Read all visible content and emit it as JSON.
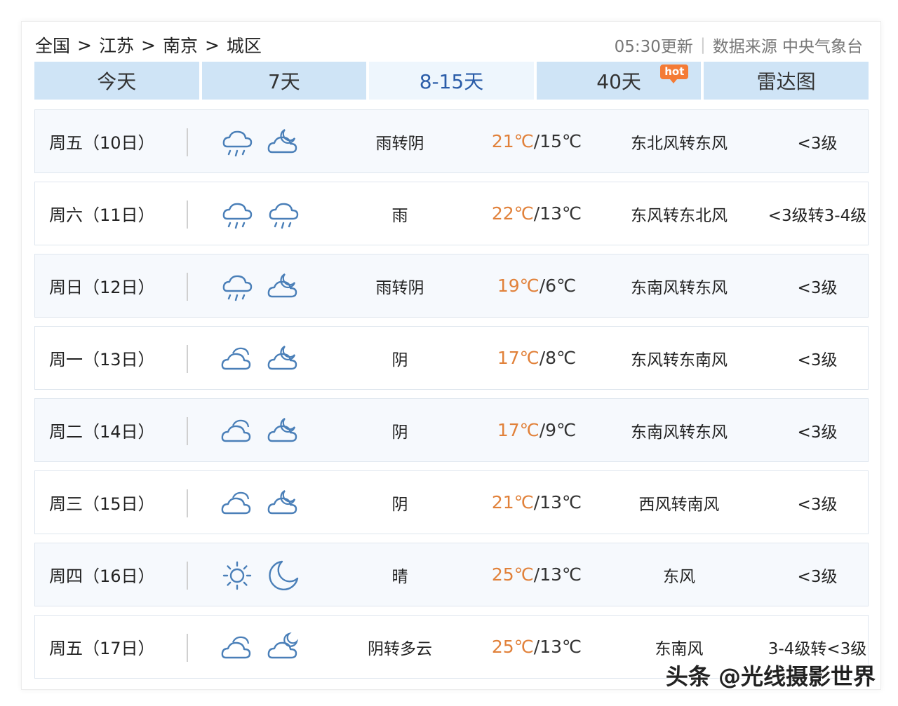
{
  "breadcrumb": [
    "全国",
    "江苏",
    "南京",
    "城区"
  ],
  "breadcrumb_sep": ">",
  "meta": {
    "update": "05:30更新",
    "divider": "|",
    "source": "数据来源 中央气象台"
  },
  "tabs": [
    {
      "label": "今天",
      "active": false
    },
    {
      "label": "7天",
      "active": false
    },
    {
      "label": "8-15天",
      "active": true
    },
    {
      "label": "40天",
      "active": false,
      "badge": "hot"
    },
    {
      "label": "雷达图",
      "active": false
    }
  ],
  "rows": [
    {
      "day": "周五（10日）",
      "icons": [
        "cloud-rain-icon",
        "partly-cloudy-night-icon"
      ],
      "desc": "雨转阴",
      "hi": "21℃",
      "lo": "/15℃",
      "wind": "东北风转东风",
      "level": "<3级"
    },
    {
      "day": "周六（11日）",
      "icons": [
        "cloud-rain-icon",
        "cloud-rain-icon"
      ],
      "desc": "雨",
      "hi": "22℃",
      "lo": "/13℃",
      "wind": "东风转东北风",
      "level": "<3级转3-4级"
    },
    {
      "day": "周日（12日）",
      "icons": [
        "cloud-rain-icon",
        "partly-cloudy-night-icon"
      ],
      "desc": "雨转阴",
      "hi": "19℃",
      "lo": "/6℃",
      "wind": "东南风转东风",
      "level": "<3级"
    },
    {
      "day": "周一（13日）",
      "icons": [
        "overcast-icon",
        "partly-cloudy-night-icon"
      ],
      "desc": "阴",
      "hi": "17℃",
      "lo": "/8℃",
      "wind": "东风转东南风",
      "level": "<3级"
    },
    {
      "day": "周二（14日）",
      "icons": [
        "overcast-icon",
        "partly-cloudy-night-icon"
      ],
      "desc": "阴",
      "hi": "17℃",
      "lo": "/9℃",
      "wind": "东南风转东风",
      "level": "<3级"
    },
    {
      "day": "周三（15日）",
      "icons": [
        "overcast-icon",
        "partly-cloudy-night-icon"
      ],
      "desc": "阴",
      "hi": "21℃",
      "lo": "/13℃",
      "wind": "西风转南风",
      "level": "<3级"
    },
    {
      "day": "周四（16日）",
      "icons": [
        "sun-icon",
        "moon-icon"
      ],
      "desc": "晴",
      "hi": "25℃",
      "lo": "/13℃",
      "wind": "东风",
      "level": "<3级"
    },
    {
      "day": "周五（17日）",
      "icons": [
        "overcast-icon",
        "cloud-moon-icon"
      ],
      "desc": "阴转多云",
      "hi": "25℃",
      "lo": "/13℃",
      "wind": "东南风",
      "level": "3-4级转<3级"
    }
  ],
  "watermark": "头条 @光线摄影世界",
  "colors": {
    "tab_bg": "#cfe4f6",
    "tab_active_text": "#2a5ca8",
    "temp_high": "#e1813a",
    "icon_stroke": "#4a7fb8",
    "hot_badge": "#f47b36"
  }
}
